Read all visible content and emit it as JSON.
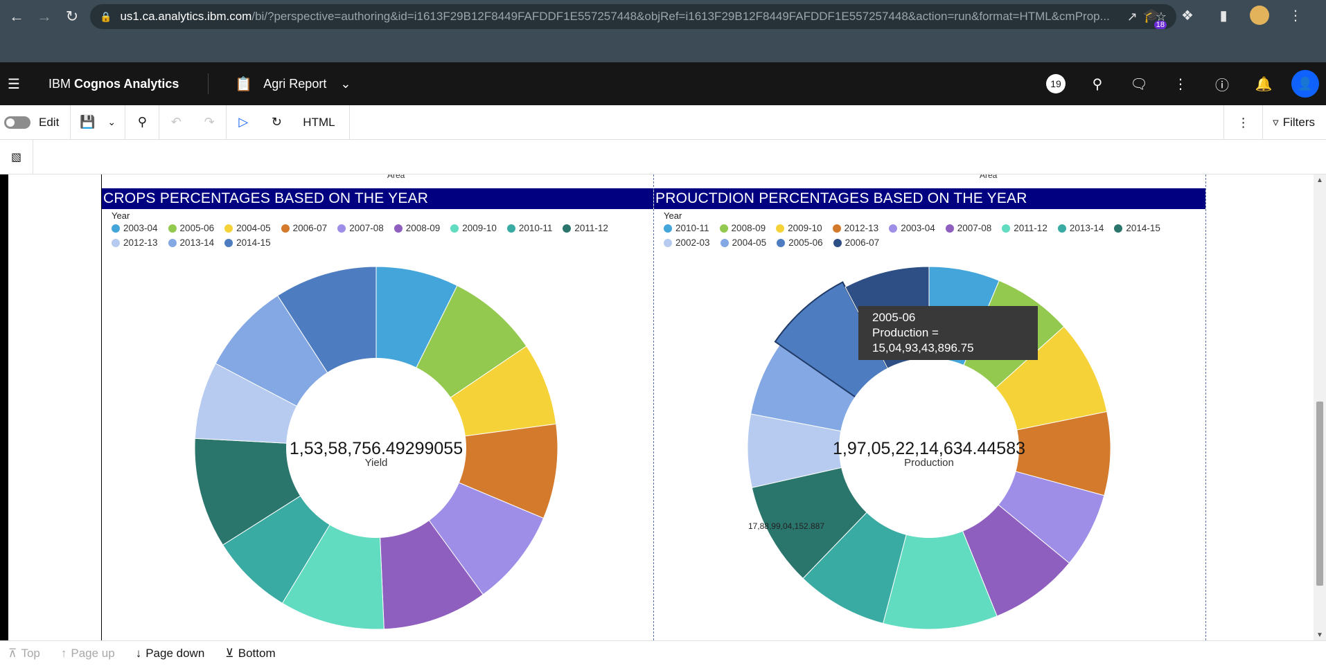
{
  "browser": {
    "url_host": "us1.ca.analytics.ibm.com",
    "url_rest": "/bi/?perspective=authoring&id=i1613F29B12F8449FAFDDF1E557257448&objRef=i1613F29B12F8449FAFDDF1E557257448&action=run&format=HTML&cmProp...",
    "extension_badge": "18"
  },
  "header": {
    "brand_prefix": "IBM ",
    "brand_bold": "Cognos Analytics",
    "report_title": "Agri Report",
    "notification_count": "19"
  },
  "toolbar": {
    "edit_label": "Edit",
    "format_label": "HTML",
    "filters_label": "Filters"
  },
  "report": {
    "left": {
      "area_stub": "Area",
      "title": "CROPS PERCENTAGES BASED ON THE YEAR",
      "legend_title": "Year",
      "center_total": "1,53,58,756.49299055",
      "center_label": "Yield"
    },
    "right": {
      "area_stub": "Area",
      "title": "PROUCTDION PERCENTAGES BASED ON THE YEAR",
      "legend_title": "Year",
      "center_total": "1,97,05,22,14,634.44583",
      "center_label": "Production",
      "slice_label": "17,88,99,04,152.887"
    },
    "tooltip": {
      "line1": "2005-06",
      "line2": "Production =",
      "line3": "15,04,93,43,896.75"
    }
  },
  "pager": {
    "top": "Top",
    "page_up": "Page up",
    "page_down": "Page down",
    "bottom": "Bottom"
  },
  "chart_data": [
    {
      "type": "pie",
      "donut": true,
      "title": "CROPS PERCENTAGES BASED ON THE YEAR",
      "legend_title": "Year",
      "center_total": "1,53,58,756.49299055",
      "center_label": "Yield",
      "categories": [
        "2003-04",
        "2005-06",
        "2004-05",
        "2006-07",
        "2007-08",
        "2008-09",
        "2009-10",
        "2010-11",
        "2011-12",
        "2012-13",
        "2013-14",
        "2014-15"
      ],
      "colors": [
        "#44a5da",
        "#94c94f",
        "#f5d338",
        "#d37a2d",
        "#9f8ee8",
        "#8e5fbf",
        "#62dcc1",
        "#39aba2",
        "#2a756c",
        "#b6cbef",
        "#84a8e3",
        "#4d7cc1"
      ],
      "values": [
        7.5,
        8.3,
        7.5,
        8.6,
        8.8,
        9.5,
        9.5,
        7.5,
        10.0,
        7.0,
        8.3,
        9.3
      ]
    },
    {
      "type": "pie",
      "donut": true,
      "title": "PROUCTDION PERCENTAGES BASED ON THE YEAR",
      "legend_title": "Year",
      "center_total": "1,97,05,22,14,634.44583",
      "center_label": "Production",
      "categories": [
        "2010-11",
        "2008-09",
        "2009-10",
        "2012-13",
        "2003-04",
        "2007-08",
        "2011-12",
        "2013-14",
        "2014-15",
        "2002-03",
        "2004-05",
        "2005-06",
        "2006-07"
      ],
      "colors": [
        "#44a5da",
        "#94c94f",
        "#f5d338",
        "#d37a2d",
        "#9f8ee8",
        "#8e5fbf",
        "#62dcc1",
        "#39aba2",
        "#2a756c",
        "#b6cbef",
        "#84a8e3",
        "#4d7cc1",
        "#2d4f86"
      ],
      "values": [
        6.2,
        6.9,
        8.3,
        7.3,
        6.6,
        7.8,
        10.0,
        8.0,
        9.1,
        6.4,
        6.5,
        7.6,
        7.5
      ],
      "highlighted": "2005-06"
    }
  ]
}
